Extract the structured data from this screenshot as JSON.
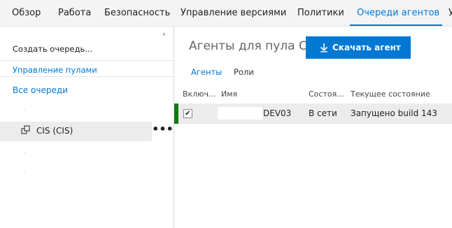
{
  "topnav": {
    "tabs": [
      {
        "label": "Обзор",
        "active": false
      },
      {
        "label": "Работа",
        "active": false
      },
      {
        "label": "Безопасность",
        "active": false
      },
      {
        "label": "Управление версиями",
        "active": false
      },
      {
        "label": "Политики",
        "active": false
      },
      {
        "label": "Очереди агентов",
        "active": true
      },
      {
        "label": "У",
        "active": false
      }
    ]
  },
  "sidebar": {
    "collapse_icon": "chevron-left-icon",
    "create_queue": "Создать очередь...",
    "manage_pools": "Управление пулами",
    "all_queues": "Все очереди",
    "selected_queue": {
      "label": "CIS (CIS)",
      "icon": "queue-icon",
      "more": "•••"
    }
  },
  "main": {
    "title": "Агенты для пула CIS",
    "download_button": {
      "label": "Скачать агент",
      "icon": "download-icon"
    },
    "tabs": [
      {
        "label": "Агенты",
        "active": true
      },
      {
        "label": "Роли",
        "active": false
      }
    ],
    "table": {
      "headers": [
        "Включ...",
        "Имя",
        "Состоя...",
        "Текущее состояние"
      ],
      "rows": [
        {
          "enabled": true,
          "name": "DEV03",
          "status": "В сети",
          "current_state": "Запущено build 143"
        }
      ]
    }
  },
  "colors": {
    "accent": "#0078d4",
    "online": "#107c10",
    "selection": "#ececec"
  }
}
